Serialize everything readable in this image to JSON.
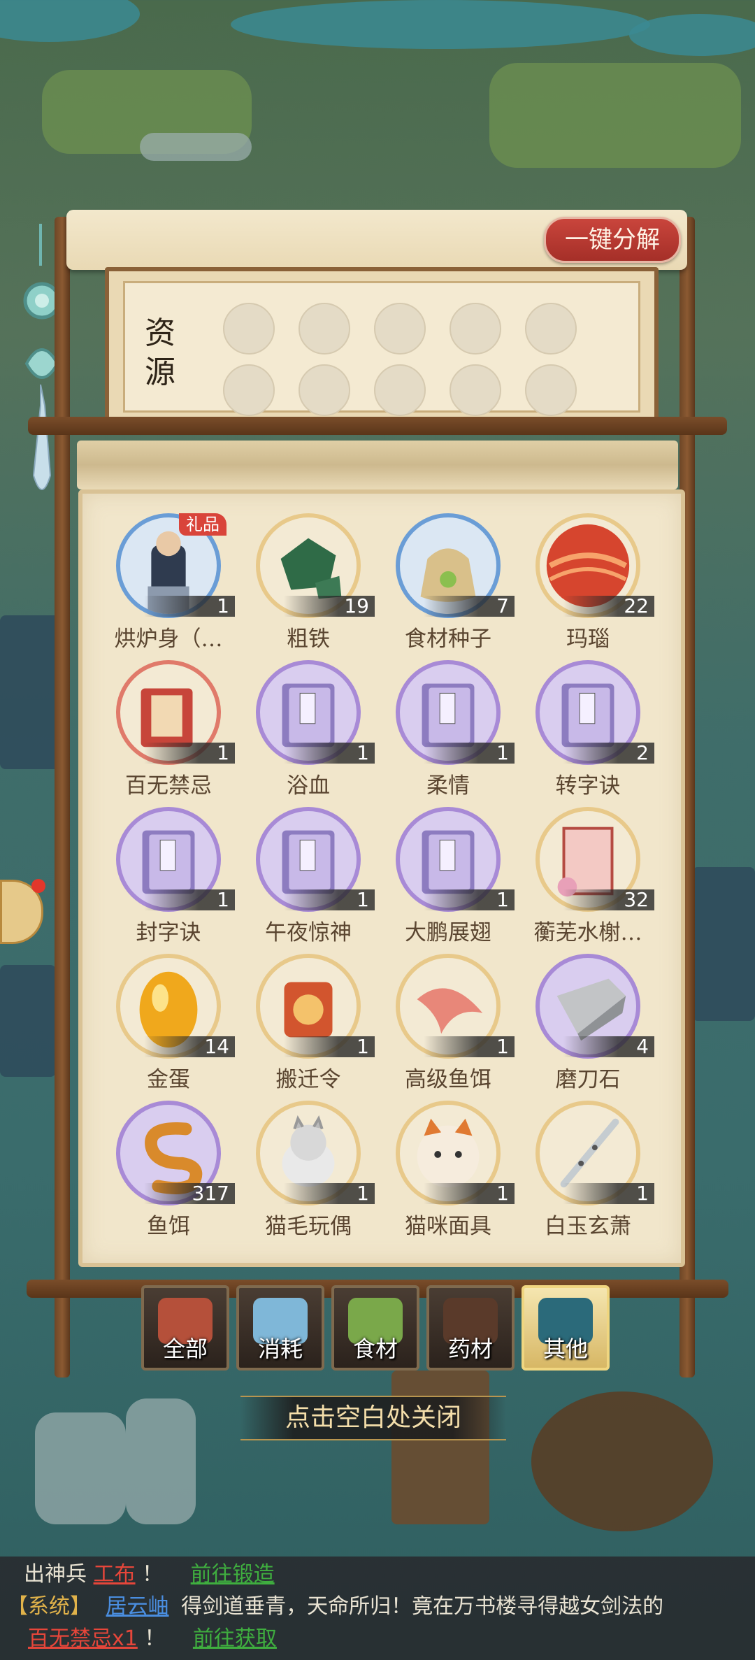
{
  "colors": {
    "accent_red": "#c9453c",
    "panel_bg": "#f1e6cb",
    "frame_gold": "#e8c98a"
  },
  "header": {
    "decompose_label": "一键分解"
  },
  "resources": {
    "label": "资源",
    "slots_count": 10
  },
  "items": [
    {
      "name": "烘炉身（…",
      "count": "1",
      "tag": "礼品",
      "icon": "character-icon",
      "ring": "#6a9dd6"
    },
    {
      "name": "粗铁",
      "count": "19",
      "icon": "iron-ore-icon",
      "ring": "#e8c98a"
    },
    {
      "name": "食材种子",
      "count": "7",
      "icon": "seed-bag-icon",
      "ring": "#6a9dd6"
    },
    {
      "name": "玛瑙",
      "count": "22",
      "icon": "agate-icon",
      "ring": "#e8c98a"
    },
    {
      "name": "百无禁忌",
      "count": "1",
      "icon": "talisman-book-icon",
      "ring": "#e07a6a"
    },
    {
      "name": "浴血",
      "count": "1",
      "icon": "skill-book-icon",
      "ring": "#a88ad6"
    },
    {
      "name": "柔情",
      "count": "1",
      "icon": "skill-book-icon",
      "ring": "#a88ad6"
    },
    {
      "name": "转字诀",
      "count": "2",
      "icon": "skill-book-icon",
      "ring": "#a88ad6"
    },
    {
      "name": "封字诀",
      "count": "1",
      "icon": "skill-book-icon",
      "ring": "#a88ad6"
    },
    {
      "name": "午夜惊神",
      "count": "1",
      "icon": "skill-book-icon",
      "ring": "#a88ad6"
    },
    {
      "name": "大鹏展翅",
      "count": "1",
      "icon": "skill-book-icon",
      "ring": "#a88ad6"
    },
    {
      "name": "蘅芜水榭…",
      "count": "32",
      "icon": "scroll-card-icon",
      "ring": "#e8c98a"
    },
    {
      "name": "金蛋",
      "count": "14",
      "icon": "golden-egg-icon",
      "ring": "#e8c98a"
    },
    {
      "name": "搬迁令",
      "count": "1",
      "icon": "relocation-token-icon",
      "ring": "#e8c98a"
    },
    {
      "name": "高级鱼饵",
      "count": "1",
      "icon": "fish-bait-icon",
      "ring": "#e8c98a"
    },
    {
      "name": "磨刀石",
      "count": "4",
      "icon": "whetstone-icon",
      "ring": "#a88ad6"
    },
    {
      "name": "鱼饵",
      "count": "317",
      "icon": "worm-icon",
      "ring": "#a88ad6"
    },
    {
      "name": "猫毛玩偶",
      "count": "1",
      "icon": "cat-plush-icon",
      "ring": "#e8c98a"
    },
    {
      "name": "猫咪面具",
      "count": "1",
      "icon": "cat-mask-icon",
      "ring": "#e8c98a"
    },
    {
      "name": "白玉玄萧",
      "count": "1",
      "icon": "jade-flute-icon",
      "ring": "#e8c98a"
    }
  ],
  "tabs": [
    {
      "label": "全部",
      "active": false
    },
    {
      "label": "消耗",
      "active": false
    },
    {
      "label": "食材",
      "active": false
    },
    {
      "label": "药材",
      "active": false
    },
    {
      "label": "其他",
      "active": true
    }
  ],
  "close_hint": "点击空白处关闭",
  "chat": {
    "line1": {
      "prefix": "出神兵",
      "item": "工布",
      "bang": "！",
      "link": "前往锻造"
    },
    "line2": {
      "tag": "【系统】",
      "player": "居云岫",
      "text": "得剑道垂青，天命所归！竟在万书楼寻得越女剑法的"
    },
    "line3": {
      "item": "百无禁忌x1",
      "bang": "！",
      "link": "前往获取"
    }
  }
}
